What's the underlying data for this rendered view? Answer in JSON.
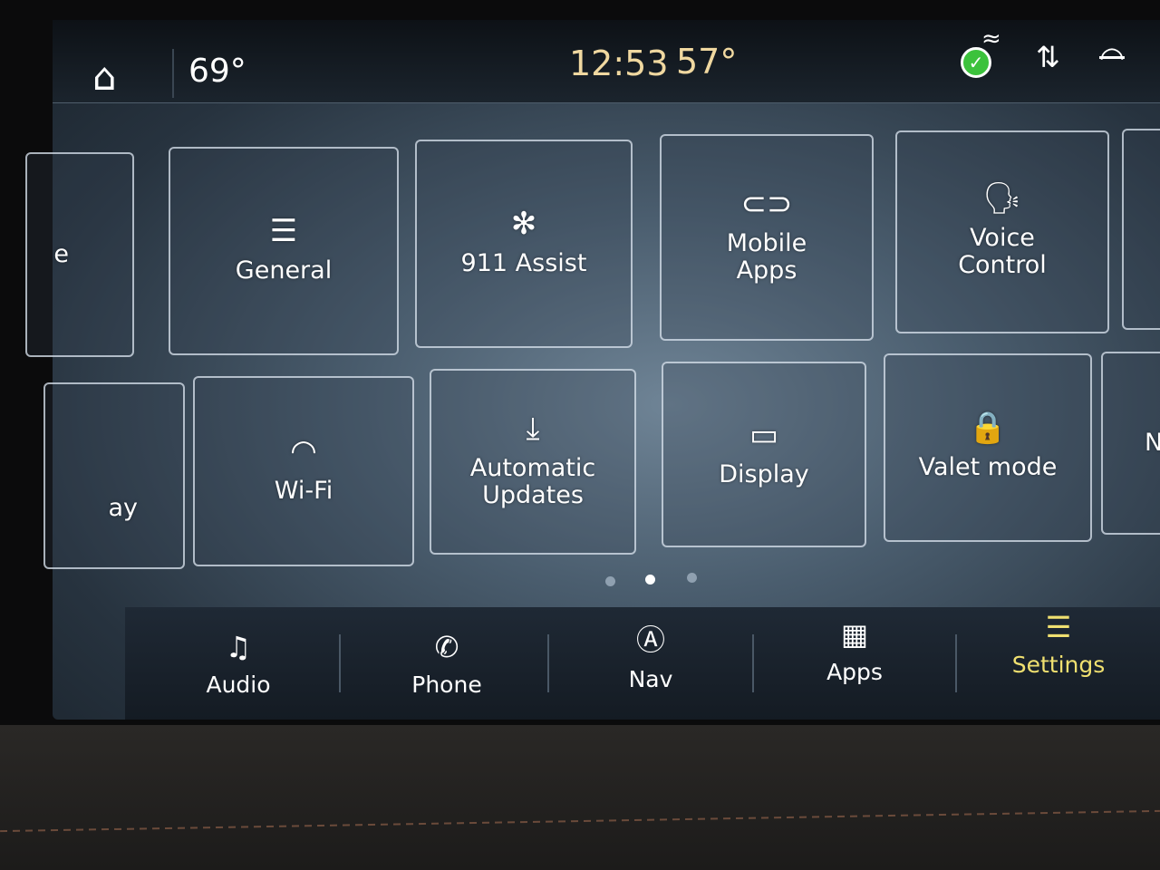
{
  "status_bar": {
    "home_icon": "home-icon",
    "interior_temp": "69°",
    "time": "12:53",
    "outside_temp": "57°",
    "icons": [
      "connected-service-check-icon",
      "data-transfer-icon",
      "wifi-off-icon"
    ]
  },
  "colors": {
    "clock": "#f0d8a0",
    "active_nav": "#f0e070",
    "check_green": "#3cc23c"
  },
  "tiles_row1": [
    {
      "label": "e",
      "partial": true
    },
    {
      "label": "General",
      "icon": "sliders-icon"
    },
    {
      "label": "911 Assist",
      "icon": "asterisk-icon"
    },
    {
      "label": "Mobile Apps",
      "icon": "link-icon"
    },
    {
      "label": "Voice Control",
      "icon": "voice-icon"
    }
  ],
  "tiles_row2": [
    {
      "label": "ay",
      "partial": true
    },
    {
      "label": "Wi-Fi",
      "icon": "wifi-icon"
    },
    {
      "label": "Automatic Updates",
      "icon": "download-icon"
    },
    {
      "label": "Display",
      "icon": "display-icon"
    },
    {
      "label": "Valet mode",
      "icon": "valet-lock-icon"
    },
    {
      "label": "N",
      "partial": true
    }
  ],
  "pagination": {
    "pages": 3,
    "current": 2
  },
  "nav": [
    {
      "label": "Audio",
      "icon": "music-note-icon"
    },
    {
      "label": "Phone",
      "icon": "phone-icon"
    },
    {
      "label": "Nav",
      "icon": "navigation-icon"
    },
    {
      "label": "Apps",
      "icon": "apps-grid-icon"
    },
    {
      "label": "Settings",
      "icon": "settings-sliders-icon",
      "active": true
    }
  ]
}
